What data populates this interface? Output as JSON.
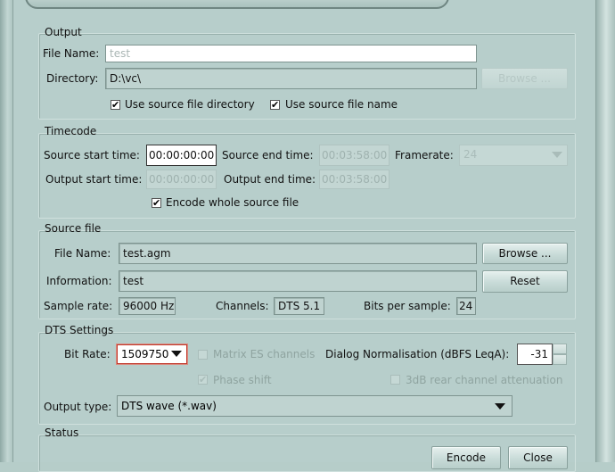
{
  "output": {
    "title": "Output",
    "file_name_label": "File Name:",
    "file_name_value": "test",
    "directory_label": "Directory:",
    "directory_value": "D:\\vc\\",
    "browse_label": "Browse ...",
    "use_source_dir_label": "Use source file directory",
    "use_source_name_label": "Use source file name",
    "use_source_dir_checked": true,
    "use_source_name_checked": true
  },
  "timecode": {
    "title": "Timecode",
    "source_start_label": "Source start time:",
    "source_start_value": "00:00:00:00",
    "source_end_label": "Source end time:",
    "source_end_value": "00:03:58:00",
    "framerate_label": "Framerate:",
    "framerate_value": "24",
    "output_start_label": "Output start time:",
    "output_start_value": "00:00:00:00",
    "output_end_label": "Output end time:",
    "output_end_value": "00:03:58:00",
    "encode_whole_label": "Encode whole source file",
    "encode_whole_checked": true
  },
  "source_file": {
    "title": "Source file",
    "file_name_label": "File Name:",
    "file_name_value": "test.agm",
    "browse_label": "Browse ...",
    "information_label": "Information:",
    "information_value": "test",
    "reset_label": "Reset",
    "sample_rate_label": "Sample rate:",
    "sample_rate_value": "96000 Hz",
    "channels_label": "Channels:",
    "channels_value": "DTS 5.1",
    "bits_label": "Bits per sample:",
    "bits_value": "24"
  },
  "dts_settings": {
    "title": "DTS Settings",
    "bit_rate_label": "Bit Rate:",
    "bit_rate_value": "1509750",
    "matrix_es_label": "Matrix ES channels",
    "dialog_norm_label": "Dialog Normalisation (dBFS LeqA):",
    "dialog_norm_value": "-31",
    "phase_shift_label": "Phase shift",
    "phase_shift_checked": true,
    "rear_atten_label": "3dB rear channel attenuation",
    "output_type_label": "Output type:",
    "output_type_value": "DTS wave (*.wav)"
  },
  "status": {
    "title": "Status",
    "encode_label": "Encode",
    "close_label": "Close"
  }
}
